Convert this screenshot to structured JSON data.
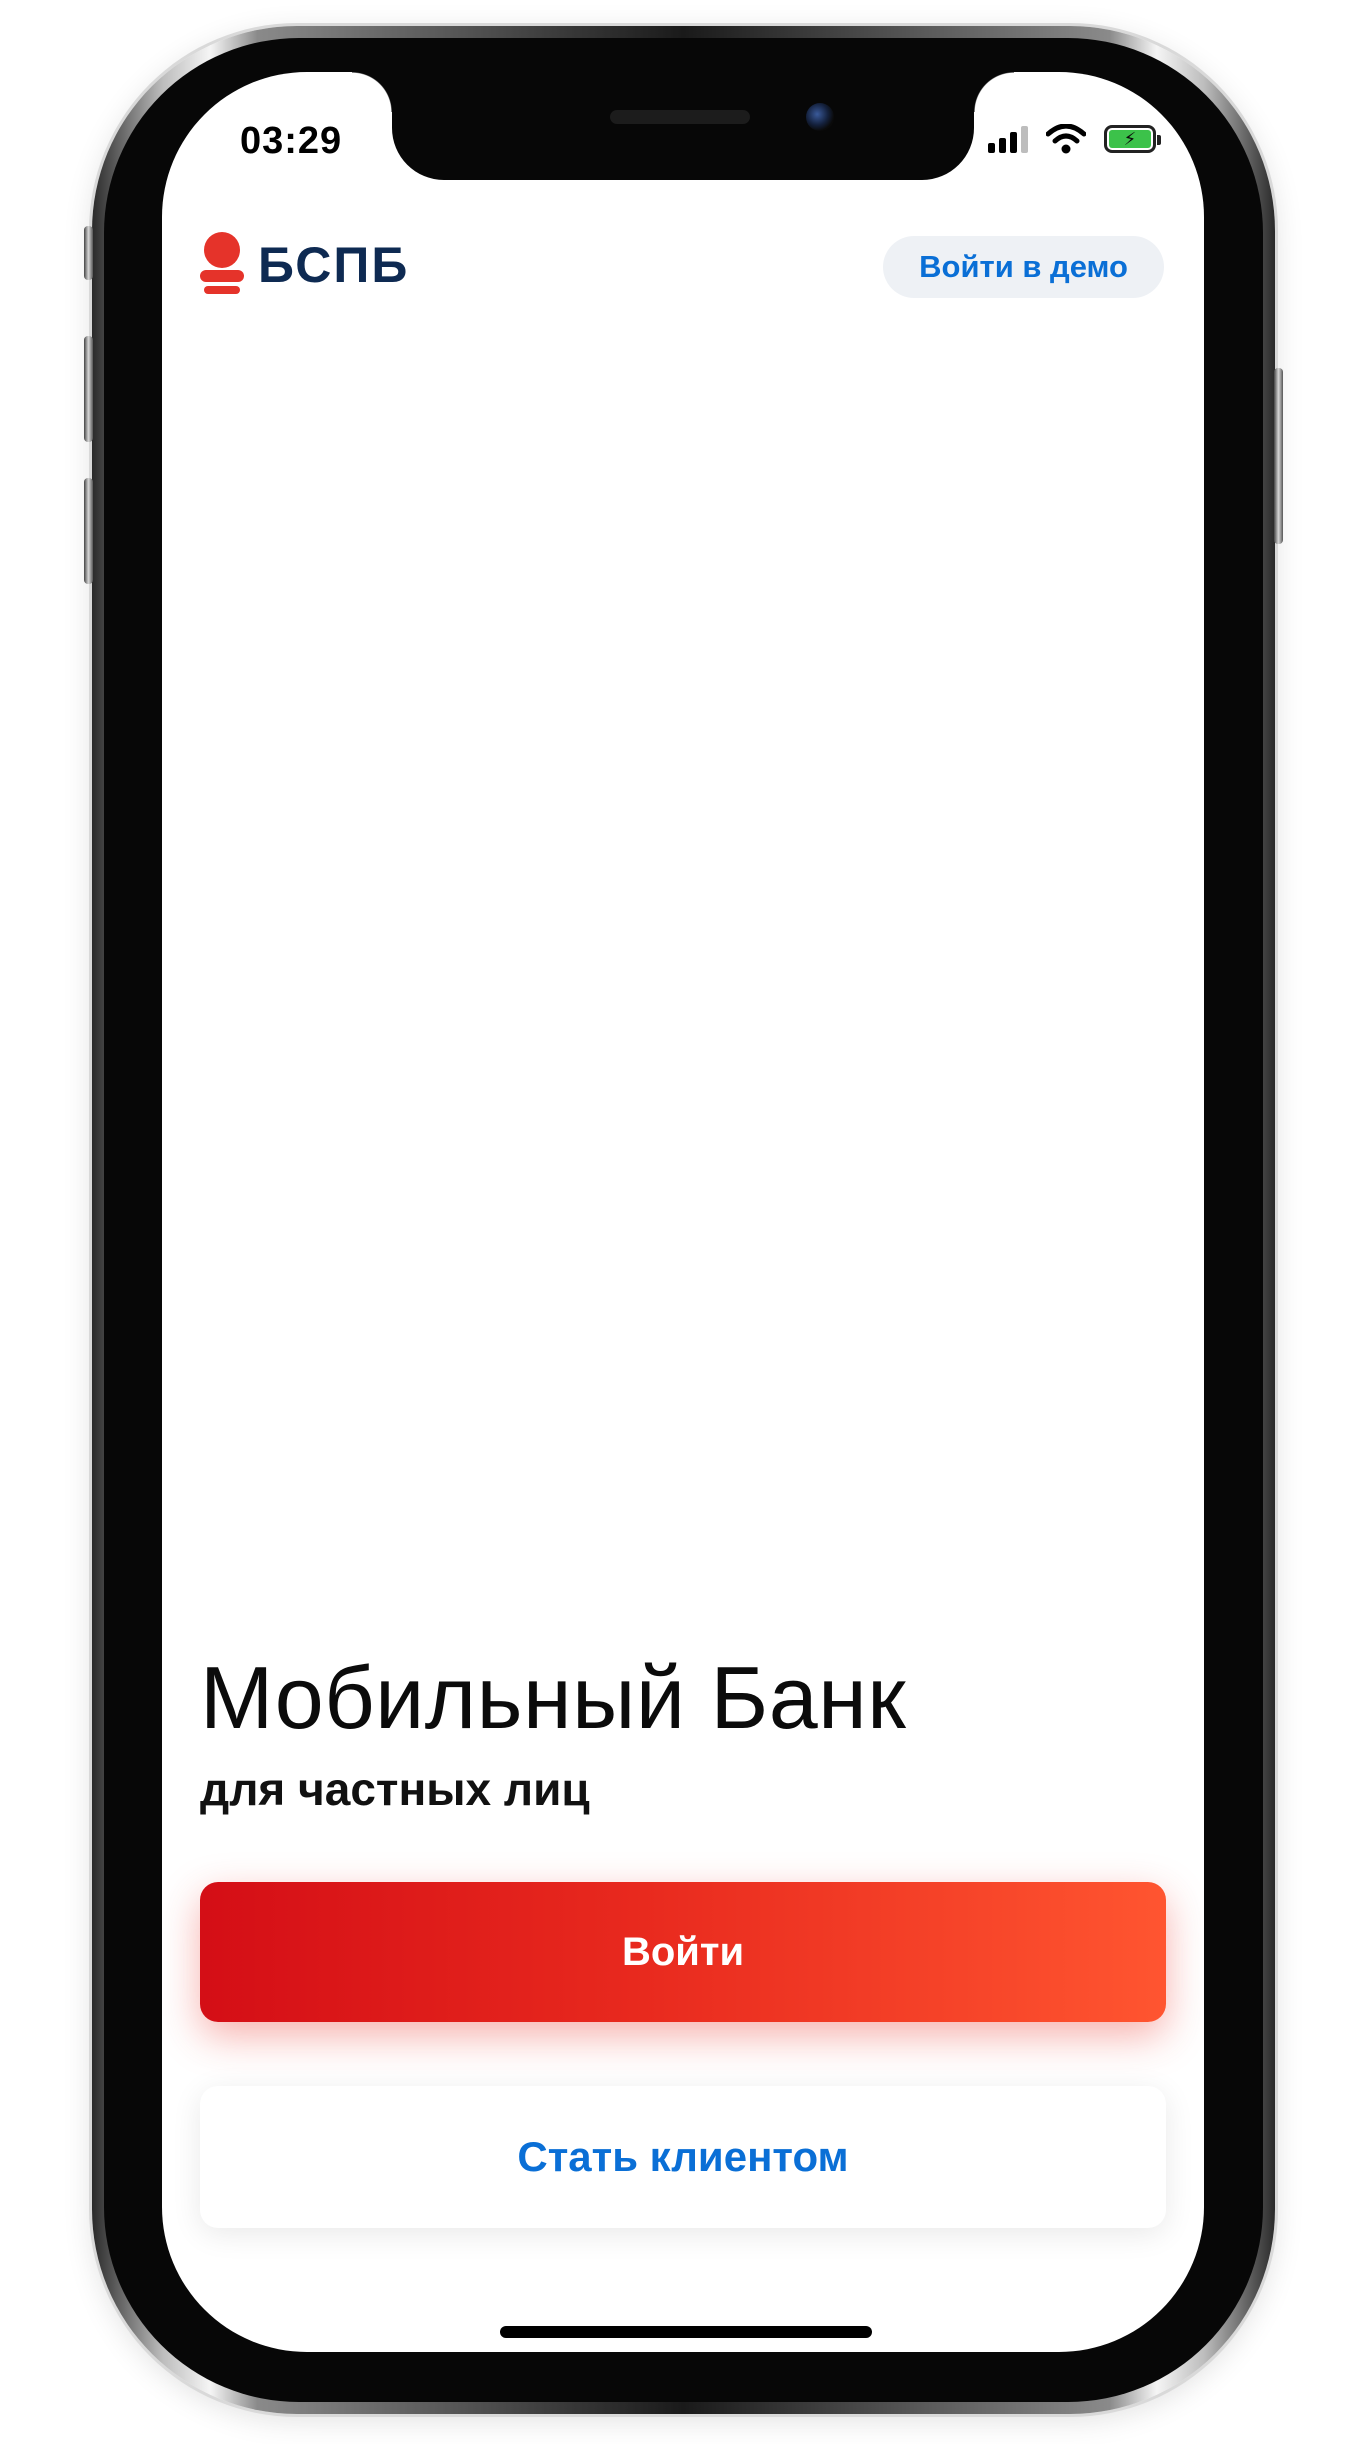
{
  "status_bar": {
    "time": "03:29",
    "icons": [
      "cellular-signal-icon",
      "wifi-icon",
      "battery-charging-icon"
    ],
    "battery_color": "#3cc24a"
  },
  "header": {
    "logo_text": "БСПБ",
    "logo_color": "#e5332a",
    "demo_button_label": "Войти в демо"
  },
  "main": {
    "title": "Мобильный Банк",
    "subtitle": "для частных лиц",
    "login_button_label": "Войти",
    "become_client_button_label": "Стать клиентом"
  },
  "colors": {
    "accent_blue": "#0a6fd6",
    "primary_gradient_start": "#d40e16",
    "primary_gradient_end": "#ff5530",
    "brand_navy": "#0e2a52"
  }
}
